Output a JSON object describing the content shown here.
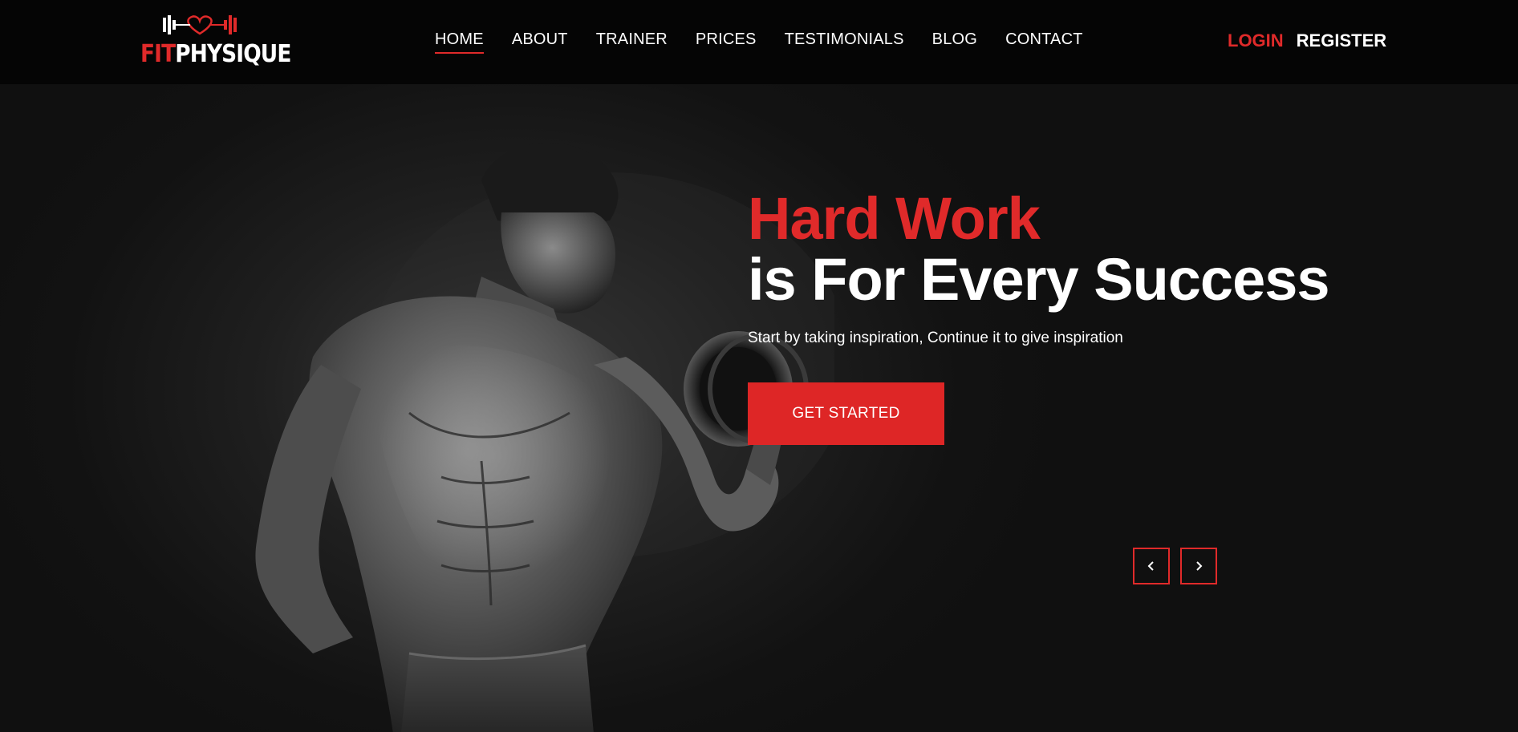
{
  "brand": {
    "logo_text_part1": "FIT",
    "logo_text_part2": "PHYSIQUE",
    "logo_icon": "dumbbell-heart-icon",
    "accent_color": "#e02a2a",
    "background_color": "#0e0e0e"
  },
  "nav": {
    "items": [
      {
        "label": "HOME",
        "active": true
      },
      {
        "label": "ABOUT",
        "active": false
      },
      {
        "label": "TRAINER",
        "active": false
      },
      {
        "label": "PRICES",
        "active": false
      },
      {
        "label": "TESTIMONIALS",
        "active": false
      },
      {
        "label": "BLOG",
        "active": false
      },
      {
        "label": "CONTACT",
        "active": false
      }
    ]
  },
  "auth": {
    "login_label": "LOGIN",
    "register_label": "REGISTER"
  },
  "hero": {
    "headline_red": "Hard Work",
    "headline_white": "is For Every Success",
    "subline": "Start by taking inspiration, Continue it to give inspiration",
    "cta_label": "GET STARTED",
    "image": "muscular-man-with-dumbbell",
    "prev_icon": "chevron-left-icon",
    "next_icon": "chevron-right-icon"
  }
}
